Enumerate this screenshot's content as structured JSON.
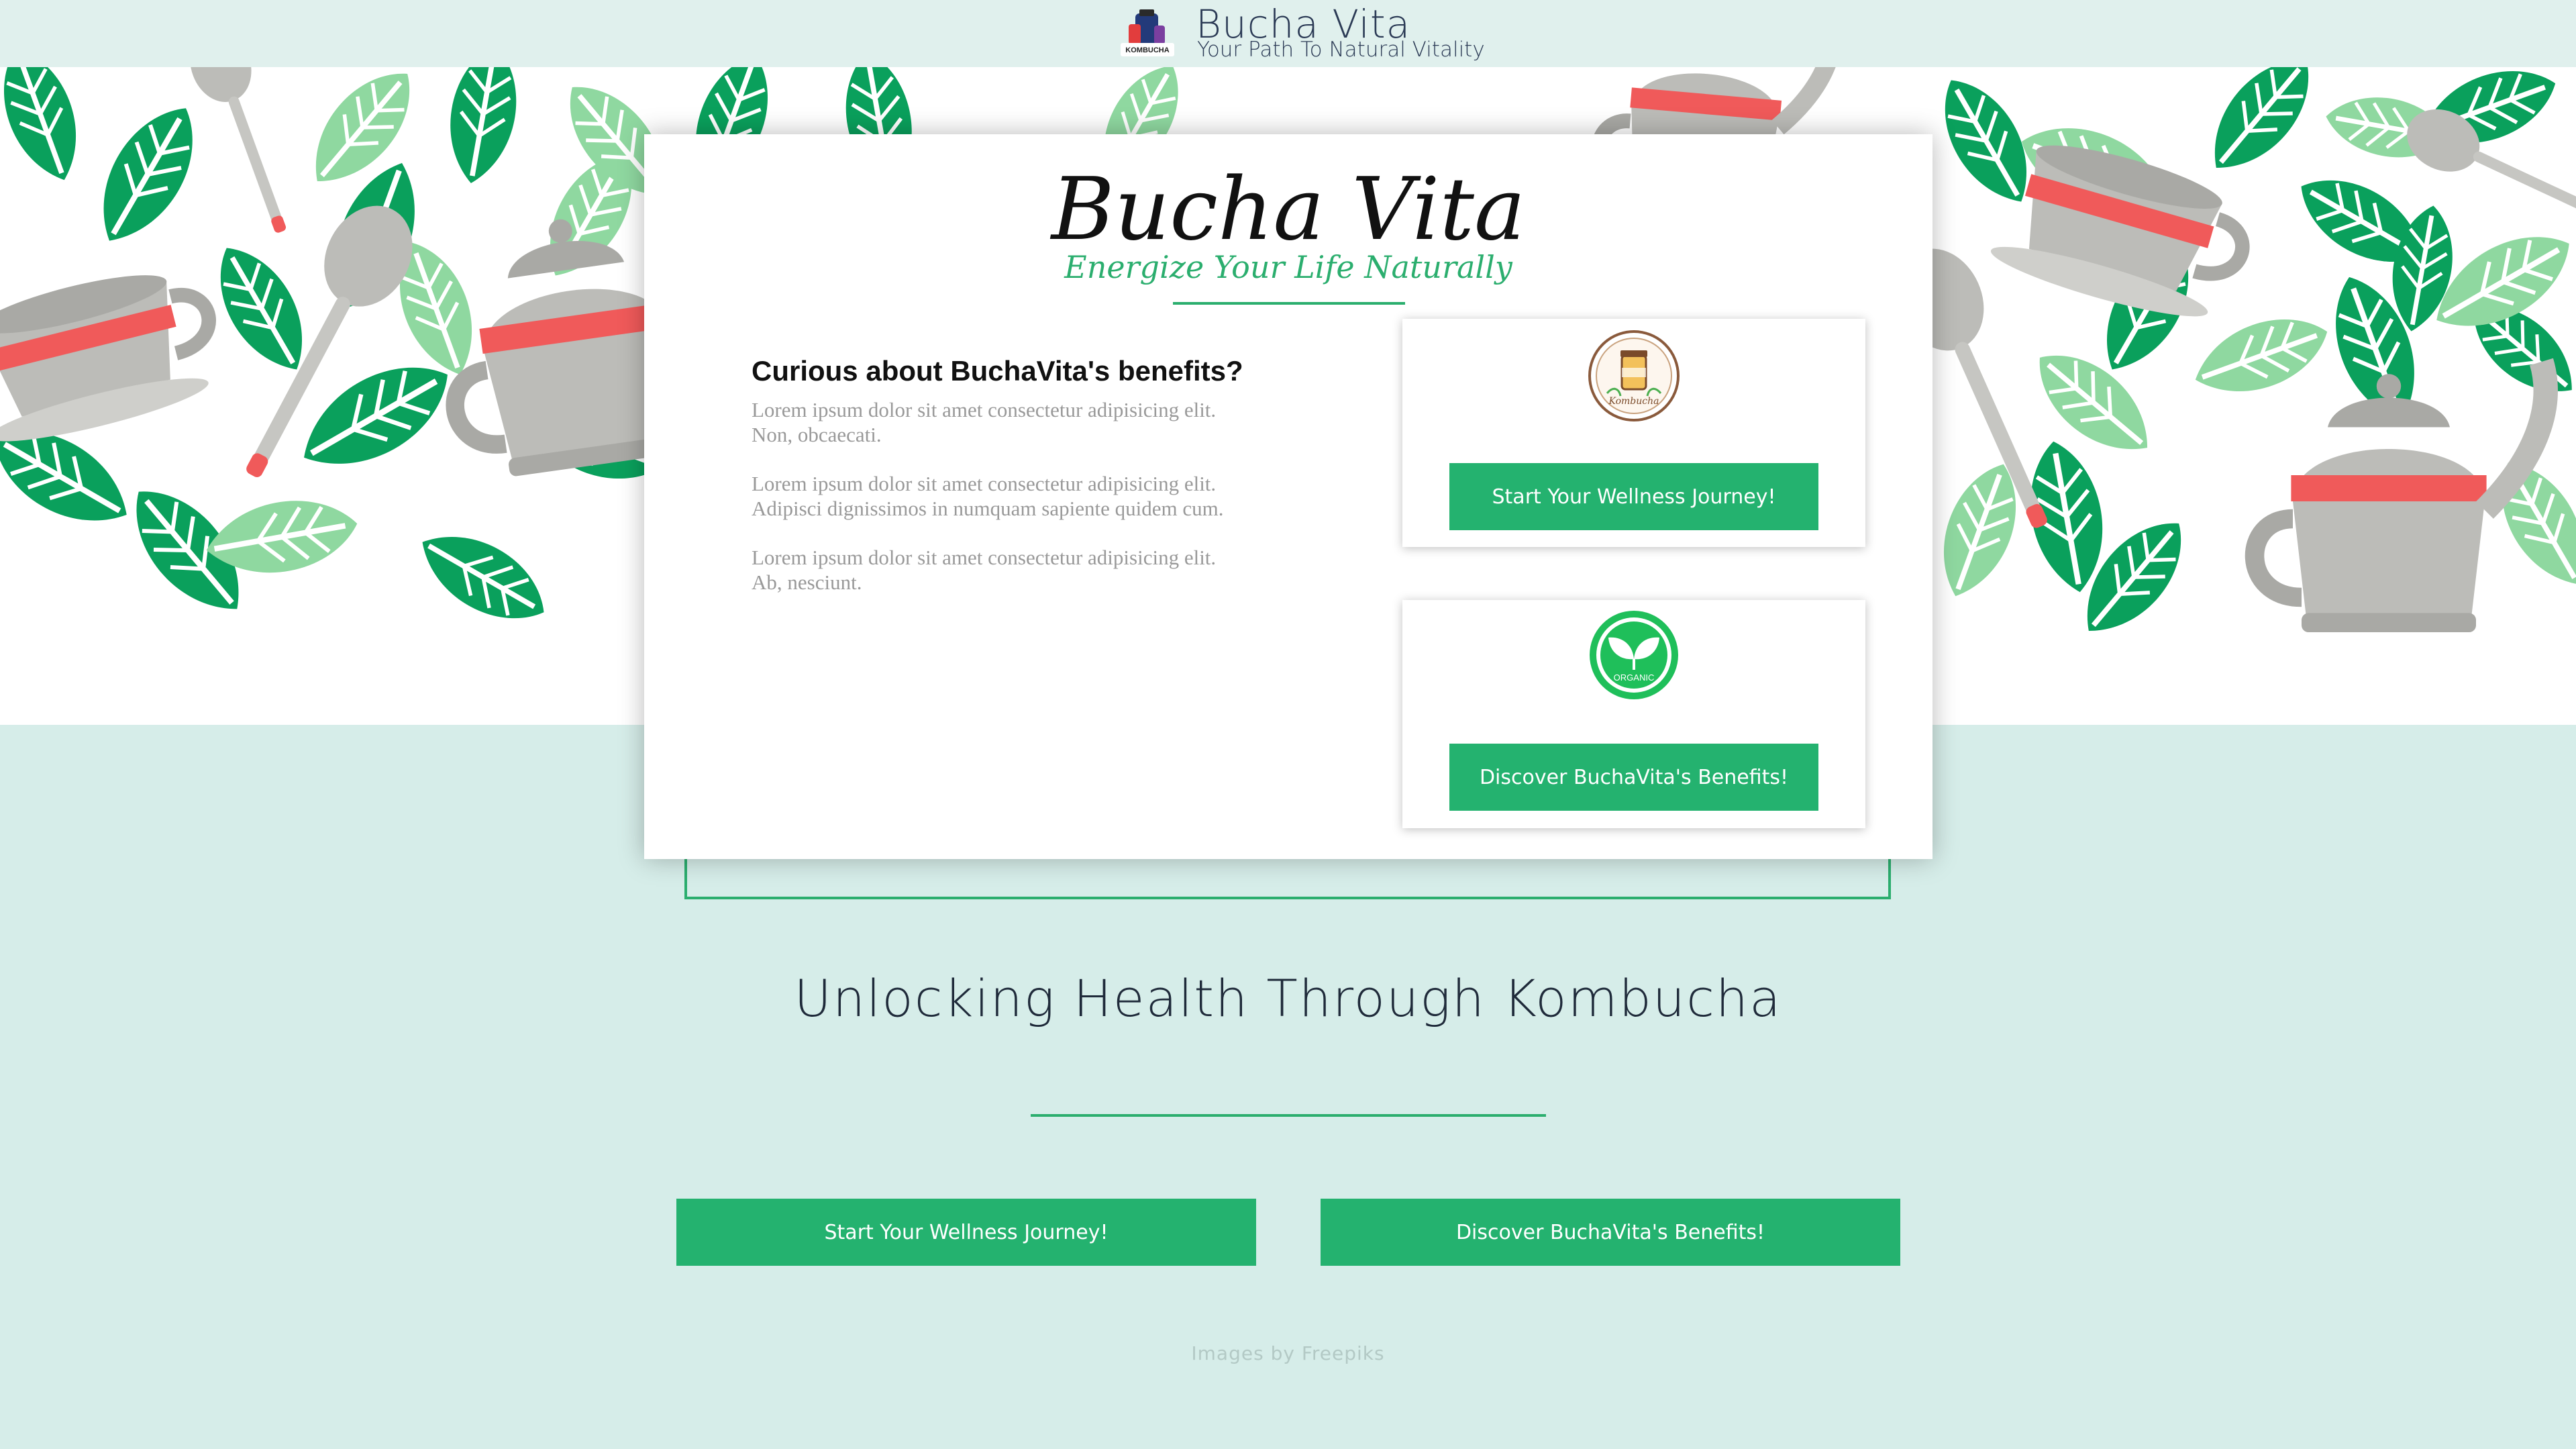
{
  "header": {
    "brand_name": "Bucha Vita",
    "tagline": "Your Path To Natural Vitality",
    "logo_text": "KOMBUCHA",
    "logo_icon": "kombucha-bottles-logo"
  },
  "hero": {
    "pattern_icons": [
      "leaf-icon",
      "teapot-icon",
      "teacup-icon",
      "spoon-icon"
    ],
    "colors": {
      "leaf_dark": "#0aa05c",
      "leaf_light": "#8fd8a0",
      "pot": "#bcbcb8",
      "band": "#f05a5a"
    }
  },
  "card": {
    "title": "Bucha Vita",
    "subtitle": "Energize Your Life Naturally",
    "benefits_heading": "Curious about BuchaVita's benefits?",
    "paragraphs": [
      [
        "Lorem ipsum dolor sit amet consectetur adipisicing elit.",
        "Non, obcaecati."
      ],
      [
        "Lorem ipsum dolor sit amet consectetur adipisicing elit.",
        "Adipisci dignissimos in numquam sapiente quidem cum."
      ],
      [
        "Lorem ipsum dolor sit amet consectetur adipisicing elit.",
        "Ab, nesciunt."
      ]
    ],
    "features": [
      {
        "icon": "kombucha-badge-icon",
        "badge_text": "Kombucha",
        "button": "Start Your Wellness Journey!"
      },
      {
        "icon": "organic-leaf-icon",
        "badge_text": "ORGANIC",
        "button": "Discover BuchaVita's Benefits!"
      }
    ]
  },
  "section": {
    "title": "Unlocking Health Through Kombucha",
    "buttons": [
      "Start Your Wellness Journey!",
      "Discover BuchaVita's Benefits!"
    ]
  },
  "footer": {
    "credit": "Images by Freepiks"
  },
  "colors": {
    "accent": "#24b26f",
    "page_bg": "#d6ede9",
    "topbar_bg": "#e0f0ed",
    "text_dark": "#2b3a55"
  }
}
